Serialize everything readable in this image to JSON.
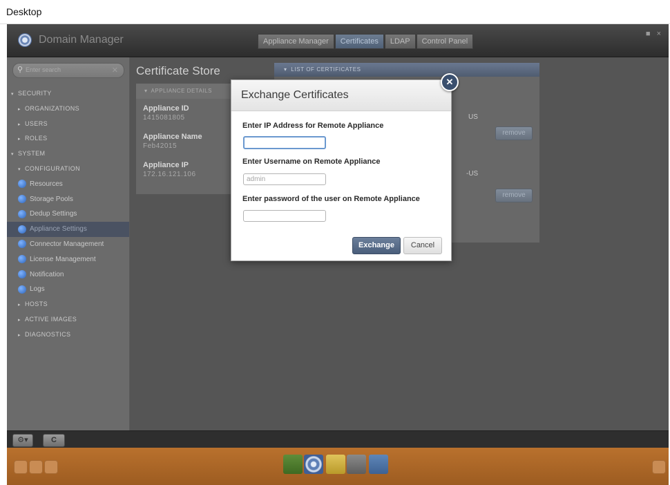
{
  "desktop": {
    "title": "Desktop"
  },
  "app": {
    "title": "Domain Manager",
    "tabs": [
      "Appliance Manager",
      "Certificates",
      "LDAP",
      "Control Panel"
    ],
    "active_tab": "Certificates",
    "window_controls": "■ ×"
  },
  "sidebar": {
    "search_placeholder": "Enter search",
    "items": [
      {
        "label": "SECURITY",
        "level": 0,
        "arrow": "▾"
      },
      {
        "label": "ORGANIZATIONS",
        "level": 1,
        "arrow": "▸"
      },
      {
        "label": "USERS",
        "level": 1,
        "arrow": "▸"
      },
      {
        "label": "ROLES",
        "level": 1,
        "arrow": "▸"
      },
      {
        "label": "SYSTEM",
        "level": 0,
        "arrow": "▾"
      },
      {
        "label": "CONFIGURATION",
        "level": 1,
        "arrow": "▾"
      },
      {
        "label": "Resources",
        "level": 2
      },
      {
        "label": "Storage Pools",
        "level": 2
      },
      {
        "label": "Dedup Settings",
        "level": 2
      },
      {
        "label": "Appliance Settings",
        "level": 2,
        "selected": true
      },
      {
        "label": "Connector Management",
        "level": 2
      },
      {
        "label": "License Management",
        "level": 2
      },
      {
        "label": "Notification",
        "level": 2
      },
      {
        "label": "Logs",
        "level": 2
      },
      {
        "label": "HOSTS",
        "level": 1,
        "arrow": "▸"
      },
      {
        "label": "ACTIVE IMAGES",
        "level": 1,
        "arrow": "▸"
      },
      {
        "label": "DIAGNOSTICS",
        "level": 1,
        "arrow": "▸"
      }
    ]
  },
  "content": {
    "title": "Certificate Store",
    "details": {
      "header": "APPLIANCE DETAILS",
      "appliance_id_label": "Appliance ID",
      "appliance_id": "1415081805",
      "appliance_name_label": "Appliance Name",
      "appliance_name": "Feb42015",
      "appliance_ip_label": "Appliance IP",
      "appliance_ip": "172.16.121.106"
    },
    "certificates": {
      "header": "LIST OF CERTIFICATES",
      "fragment_1": "US",
      "fragment_2": "-US",
      "remove_label": "remove"
    }
  },
  "toolbar": {
    "settings": "⚙▾",
    "refresh": "C"
  },
  "modal": {
    "title": "Exchange Certificates",
    "ip_label": "Enter IP Address for Remote Appliance",
    "ip_value": "",
    "username_label": "Enter Username on Remote Appliance",
    "username_placeholder": "admin",
    "password_label": "Enter password of the user on Remote Appliance",
    "password_value": "",
    "exchange_label": "Exchange",
    "cancel_label": "Cancel",
    "close_symbol": "✕"
  }
}
